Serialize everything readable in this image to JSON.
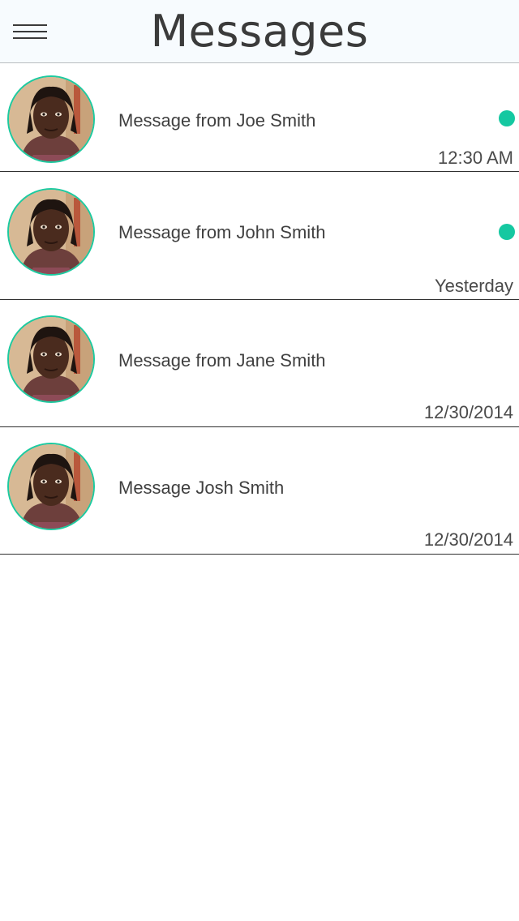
{
  "header": {
    "title": "Messages",
    "menu_icon": "hamburger-menu-icon"
  },
  "colors": {
    "accent": "#15c8a1",
    "header_bg": "#f7fbfe",
    "text": "#404040",
    "divider": "#2f2f2f"
  },
  "messages": [
    {
      "text": "Message from Joe Smith",
      "time": "12:30 AM",
      "unread": true
    },
    {
      "text": "Message from John Smith",
      "time": "Yesterday",
      "unread": true
    },
    {
      "text": "Message from Jane Smith",
      "time": "12/30/2014",
      "unread": false
    },
    {
      "text": "Message Josh Smith",
      "time": "12/30/2014",
      "unread": false
    }
  ]
}
